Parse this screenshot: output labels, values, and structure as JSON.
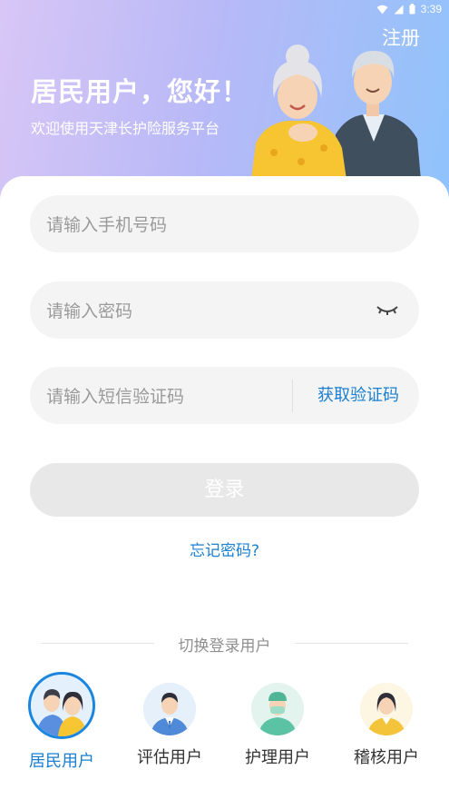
{
  "status_bar": {
    "time": "3:39"
  },
  "header": {
    "register_label": "注册",
    "greeting": "居民用户，您好！",
    "subtitle": "欢迎使用天津长护险服务平台"
  },
  "form": {
    "phone_placeholder": "请输入手机号码",
    "password_placeholder": "请输入密码",
    "sms_placeholder": "请输入短信验证码",
    "get_code_label": "获取验证码",
    "login_label": "登录",
    "forgot_label": "忘记密码?"
  },
  "switch": {
    "title": "切换登录用户",
    "users": [
      {
        "label": "居民用户",
        "icon": "resident-users-icon",
        "active": true
      },
      {
        "label": "评估用户",
        "icon": "assessor-user-icon",
        "active": false
      },
      {
        "label": "护理用户",
        "icon": "nurse-user-icon",
        "active": false
      },
      {
        "label": "稽核用户",
        "icon": "auditor-user-icon",
        "active": false
      }
    ]
  },
  "colors": {
    "accent": "#1a7fd0",
    "gradient_start": "#d8c6f6",
    "gradient_end": "#8fc3fb",
    "login_disabled": "#e8e8e8"
  }
}
